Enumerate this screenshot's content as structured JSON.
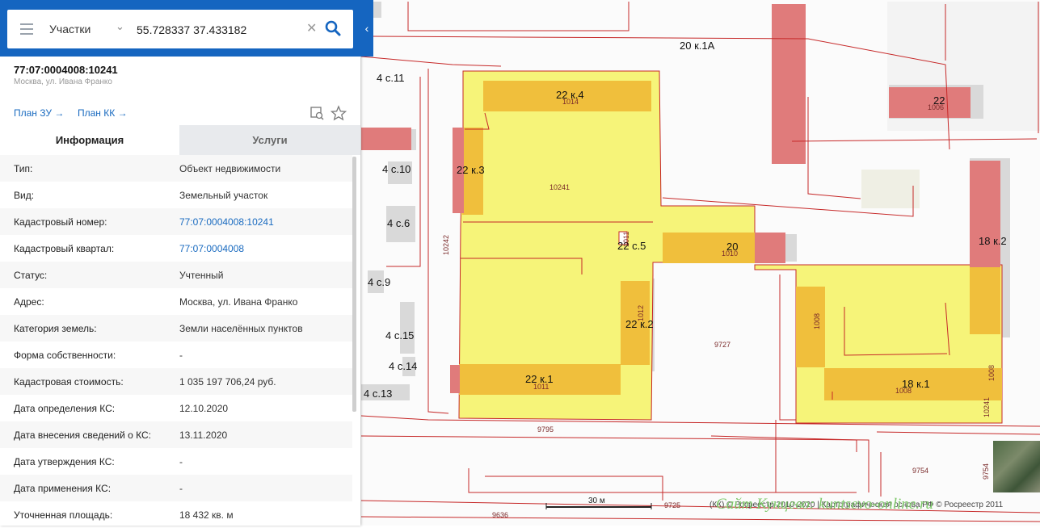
{
  "search": {
    "mode": "Участки",
    "query": "55.728337 37.433182"
  },
  "object": {
    "cad_number": "77:07:0004008:10241",
    "address": "Москва, ул. Ивана Франко"
  },
  "links": {
    "plan_zu": "План ЗУ →",
    "plan_kk": "План КК →"
  },
  "tabs": [
    {
      "label": "Информация",
      "active": true
    },
    {
      "label": "Услуги",
      "active": false
    }
  ],
  "info_rows": [
    {
      "key": "Тип:",
      "value": "Объект недвижимости",
      "link": false
    },
    {
      "key": "Вид:",
      "value": "Земельный участок",
      "link": false
    },
    {
      "key": "Кадастровый номер:",
      "value": "77:07:0004008:10241",
      "link": true
    },
    {
      "key": "Кадастровый квартал:",
      "value": "77:07:0004008",
      "link": true
    },
    {
      "key": "Статус:",
      "value": "Учтенный",
      "link": false
    },
    {
      "key": "Адрес:",
      "value": "Москва, ул. Ивана Франко",
      "link": false
    },
    {
      "key": "Категория земель:",
      "value": "Земли населённых пунктов",
      "link": false
    },
    {
      "key": "Форма собственности:",
      "value": "-",
      "link": false
    },
    {
      "key": "Кадастровая стоимость:",
      "value": "1 035 197 706,24 руб.",
      "link": false
    },
    {
      "key": "Дата определения КС:",
      "value": "12.10.2020",
      "link": false
    },
    {
      "key": "Дата внесения сведений о КС:",
      "value": "13.11.2020",
      "link": false
    },
    {
      "key": "Дата утверждения КС:",
      "value": "-",
      "link": false
    },
    {
      "key": "Дата применения КС:",
      "value": "-",
      "link": false
    },
    {
      "key": "Уточненная площадь:",
      "value": "18 432 кв. м",
      "link": false
    }
  ],
  "map": {
    "building_labels": [
      "20 к.1А",
      "22 к.4",
      "22",
      "4 с.11",
      "4 с.10",
      "22 к.3",
      "4 с.6",
      "22 с.5",
      "20",
      "18 к.2",
      "4 с.9",
      "22 к.2",
      "4 с.15",
      "4 с.14",
      "22 к.1",
      "18 к.1",
      "4 с.13"
    ],
    "parcel_numbers": [
      "1014",
      "1006",
      "10241",
      "10242",
      "1011",
      "1010",
      "1012",
      "1008",
      "9727",
      "1011",
      "1008",
      "10241",
      "1008",
      "9795",
      "9754",
      "9754",
      "9725",
      "9636"
    ],
    "scale_label": "30 м",
    "copyright": "(КК) © Росреестр 2010-2020 | Картографическая основа РФ © Росреестр 2011",
    "watermark": "Сайт Кунцево:  kuntsevo-online.ru"
  },
  "colors": {
    "header_blue": "#1565c0",
    "parcel_yellow": "#f6f479",
    "building_orange": "#f0bf3c",
    "building_red": "#e07b7b",
    "boundary_red": "#c62828",
    "link_blue": "#1a6bc0",
    "highlight_circle": "#e0102a"
  }
}
